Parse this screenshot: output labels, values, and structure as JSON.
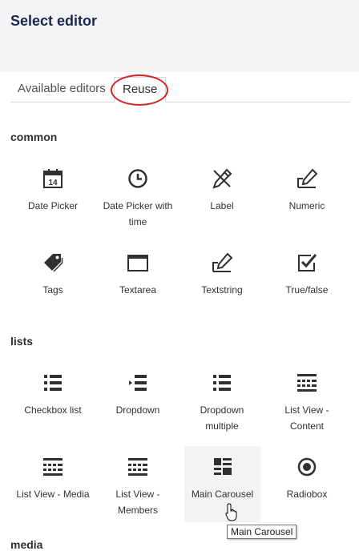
{
  "header": {
    "title": "Select editor"
  },
  "tabs": [
    {
      "label": "Available editors",
      "active": false
    },
    {
      "label": "Reuse",
      "active": true
    }
  ],
  "groups": [
    {
      "title": "common",
      "items": [
        {
          "label": "Date Picker",
          "icon": "calendar-icon"
        },
        {
          "label": "Date Picker with time",
          "icon": "clock-icon"
        },
        {
          "label": "Label",
          "icon": "pen-cross-icon"
        },
        {
          "label": "Numeric",
          "icon": "pen-box-icon"
        },
        {
          "label": "Tags",
          "icon": "tags-icon"
        },
        {
          "label": "Textarea",
          "icon": "window-icon"
        },
        {
          "label": "Textstring",
          "icon": "pen-box-icon"
        },
        {
          "label": "True/false",
          "icon": "checkbox-icon"
        }
      ]
    },
    {
      "title": "lists",
      "items": [
        {
          "label": "Checkbox list",
          "icon": "bullet-list-icon"
        },
        {
          "label": "Dropdown",
          "icon": "dropdown-list-icon"
        },
        {
          "label": "Dropdown multiple",
          "icon": "bullet-list-icon"
        },
        {
          "label": "List View - Content",
          "icon": "grid-list-icon"
        },
        {
          "label": "List View - Media",
          "icon": "grid-list-icon"
        },
        {
          "label": "List View - Members",
          "icon": "grid-list-icon"
        },
        {
          "label": "Main Carousel",
          "icon": "carousel-icon"
        },
        {
          "label": "Radiobox",
          "icon": "radio-icon"
        }
      ]
    },
    {
      "title": "media"
    }
  ],
  "tooltip": {
    "text": "Main Carousel"
  },
  "colors": {
    "header_bg": "#f3f3f5",
    "title": "#1b264f",
    "highlight_ring": "#d22222",
    "icon": "#303033"
  }
}
